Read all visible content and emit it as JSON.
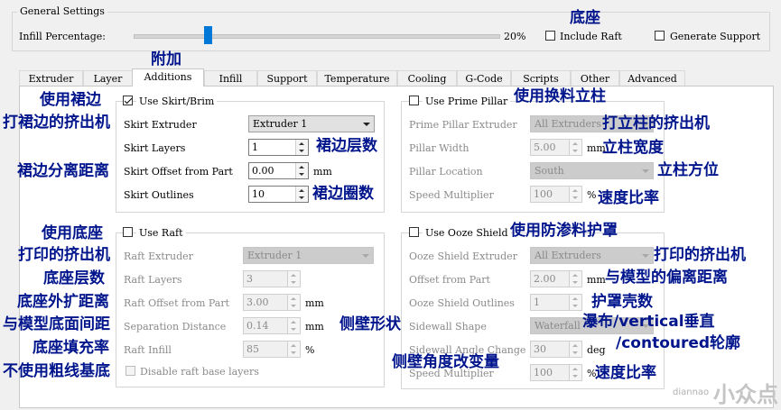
{
  "general": {
    "title": "General Settings",
    "infill_label": "Infill Percentage:",
    "infill_value_text": "20%",
    "infill_fraction": 0.2,
    "include_raft_label": "Include Raft",
    "generate_support_label": "Generate Support"
  },
  "tabs": [
    "Extruder",
    "Layer",
    "Additions",
    "Infill",
    "Support",
    "Temperature",
    "Cooling",
    "G-Code",
    "Scripts",
    "Other",
    "Advanced"
  ],
  "skirt": {
    "use_label": "Use Skirt/Brim",
    "extruder_label": "Skirt Extruder",
    "extruder_value": "Extruder 1",
    "layers_label": "Skirt Layers",
    "layers_value": "1",
    "offset_label": "Skirt Offset from Part",
    "offset_value": "0.00",
    "offset_unit": "mm",
    "outlines_label": "Skirt Outlines",
    "outlines_value": "10"
  },
  "raft": {
    "use_label": "Use Raft",
    "extruder_label": "Raft Extruder",
    "extruder_value": "Extruder 1",
    "layers_label": "Raft Layers",
    "layers_value": "3",
    "offset_label": "Raft Offset from Part",
    "offset_value": "3.00",
    "offset_unit": "mm",
    "separation_label": "Separation Distance",
    "separation_value": "0.14",
    "separation_unit": "mm",
    "infill_label": "Raft Infill",
    "infill_value": "85",
    "infill_unit": "%",
    "disable_base_label": "Disable raft base layers"
  },
  "prime": {
    "use_label": "Use Prime Pillar",
    "extruder_label": "Prime Pillar Extruder",
    "extruder_value": "All Extruders",
    "width_label": "Pillar Width",
    "width_value": "5.00",
    "width_unit": "mm",
    "location_label": "Pillar Location",
    "location_value": "South",
    "speed_label": "Speed Multiplier",
    "speed_value": "100",
    "speed_unit": "%"
  },
  "ooze": {
    "use_label": "Use Ooze Shield",
    "extruder_label": "Ooze Shield Extruder",
    "extruder_value": "All Extruders",
    "offset_label": "Offset from Part",
    "offset_value": "2.00",
    "offset_unit": "mm",
    "outlines_label": "Ooze Shield Outlines",
    "outlines_value": "1",
    "sidewall_label": "Sidewall Shape",
    "sidewall_value": "Waterfall",
    "angle_label": "Sidewall Angle Change",
    "angle_value": "30",
    "angle_unit": "deg",
    "speed_label": "Speed Multiplier",
    "speed_value": "100",
    "speed_unit": "%"
  },
  "annotations": {
    "raft_top": "底座",
    "additions_tab": "附加",
    "use_skirt": "使用裙边",
    "skirt_extruder": "打裙边的挤出机",
    "skirt_layers": "裙边层数",
    "skirt_offset": "裙边分离距离",
    "skirt_outlines": "裙边圈数",
    "use_prime": "使用换料立柱",
    "prime_extruder": "打立柱的挤出机",
    "pillar_width": "立柱宽度",
    "pillar_location": "立柱方位",
    "prime_speed": "速度比率",
    "use_raft": "使用底座",
    "raft_extruder": "打印的挤出机",
    "raft_layers": "底座层数",
    "raft_offset": "底座外扩距离",
    "raft_separation": "与模型底面间距",
    "raft_infill": "底座填充率",
    "raft_disable_base": "不使用粗线基底",
    "use_ooze": "使用防渗料护罩",
    "ooze_extruder": "打印的挤出机",
    "ooze_offset": "与模型的偏离距离",
    "ooze_outlines": "护罩壳数",
    "sidewall_shape": "侧壁形状",
    "sidewall_options_1": "瀑布/vertical垂直",
    "sidewall_options_2": "/contoured轮廓",
    "sidewall_angle": "侧壁角度改变量",
    "ooze_speed": "速度比率"
  },
  "watermark": {
    "text": "小众点",
    "sub": "diannao"
  }
}
